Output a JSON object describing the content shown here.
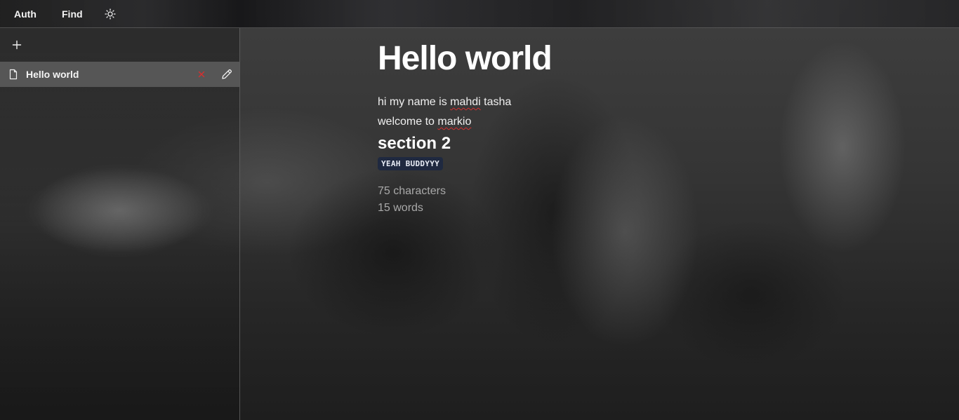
{
  "topbar": {
    "auth_label": "Auth",
    "find_label": "Find",
    "theme_icon": "sun-icon"
  },
  "sidebar": {
    "add_icon": "plus-icon",
    "notes": [
      {
        "title": "Hello world",
        "icon": "document-icon",
        "delete_icon": "close-icon",
        "edit_icon": "pencil-icon",
        "selected": true
      }
    ]
  },
  "document": {
    "title": "Hello world",
    "line1_a": "hi my name is ",
    "line1_b": "mahdi",
    "line1_c": " tasha",
    "line2_a": "welcome to ",
    "line2_b": "markio",
    "section_heading": "section 2",
    "code_text": "YEAH BUDDYYY"
  },
  "stats": {
    "characters": "75 characters",
    "words": "15 words"
  },
  "colors": {
    "delete_red": "#d62f2f",
    "code_bg": "#1f2940",
    "selected_row": "#646464"
  }
}
